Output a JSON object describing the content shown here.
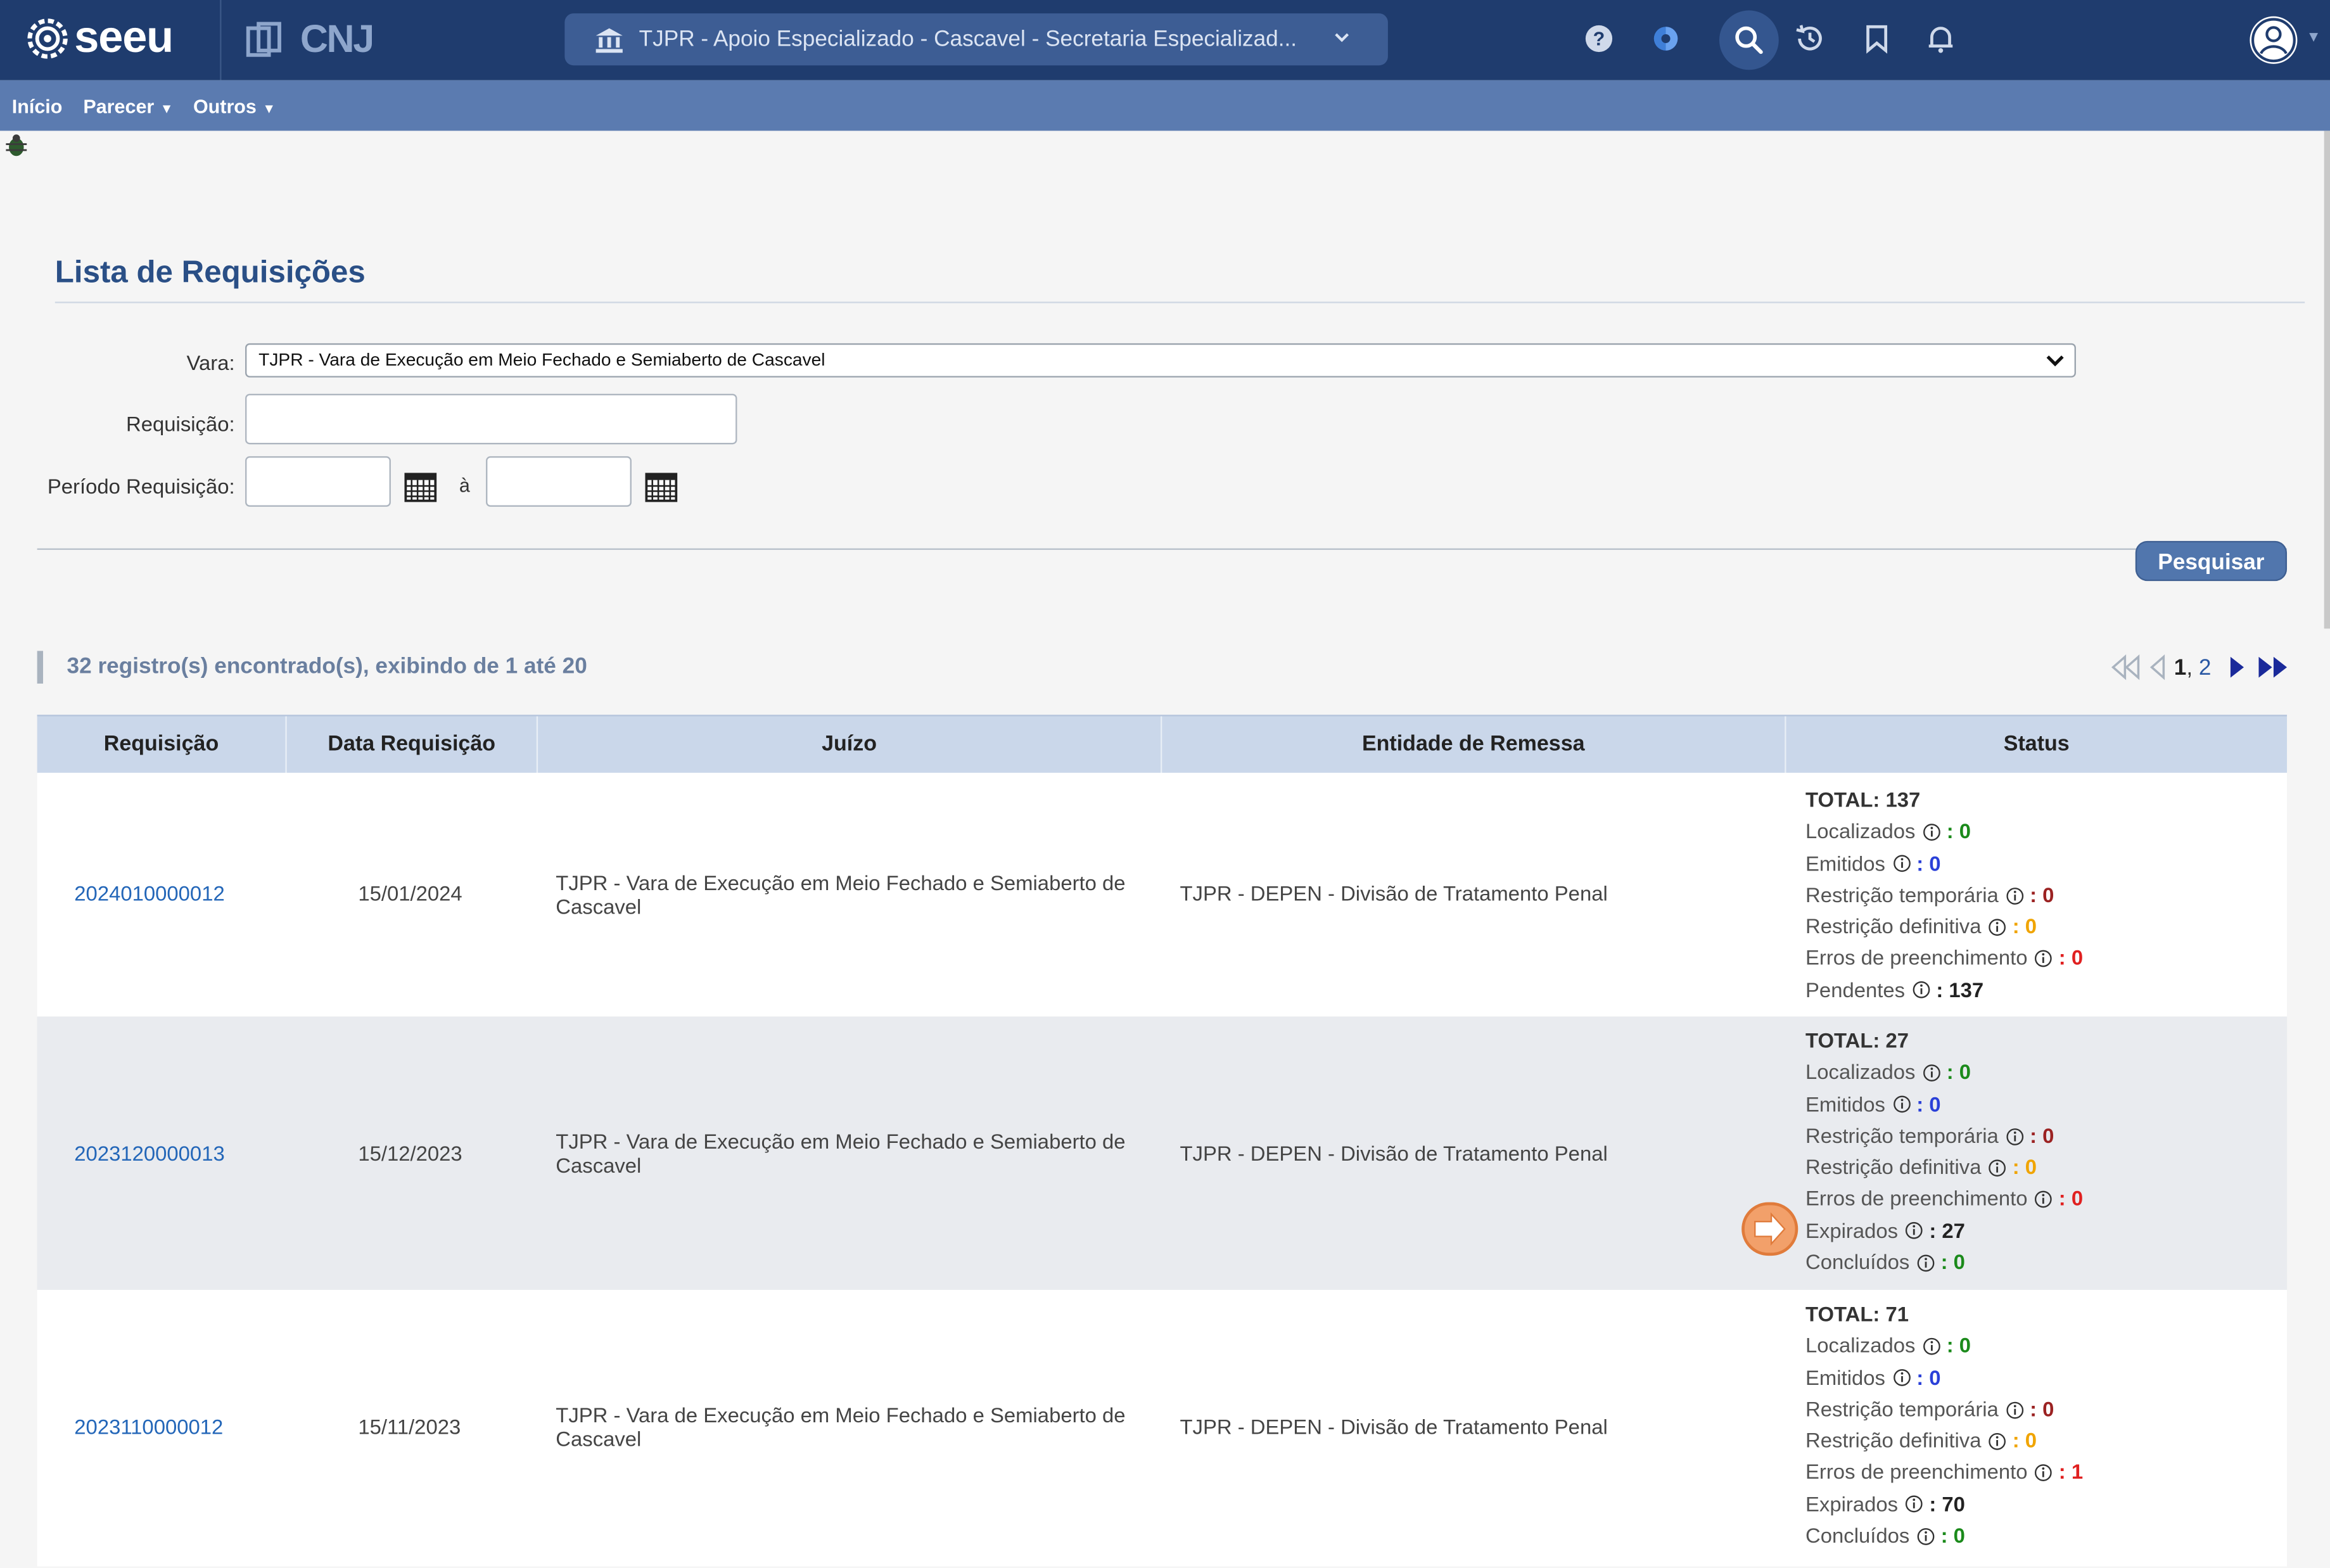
{
  "header": {
    "logo_text": "seeu",
    "cnj_text": "CNJ",
    "location": "TJPR - Apoio Especializado - Cascavel - Secretaria Especializad...",
    "icons": [
      "help-icon",
      "theme-icon",
      "search-icon",
      "history-icon",
      "bookmark-icon",
      "bell-icon",
      "user-icon"
    ],
    "colors": {
      "topbar": "#1f3c6e",
      "menubar": "#5b7bb0"
    }
  },
  "menu": {
    "inicio": "Início",
    "parecer": "Parecer",
    "outros": "Outros"
  },
  "page": {
    "title": "Lista de Requisições"
  },
  "form": {
    "vara_label": "Vara:",
    "vara_value": "TJPR - Vara de Execução em Meio Fechado e Semiaberto de Cascavel",
    "requisicao_label": "Requisição:",
    "requisicao_value": "",
    "periodo_label": "Período Requisição:",
    "periodo_sep": "à",
    "periodo_inicio": "",
    "periodo_fim": "",
    "search_button": "Pesquisar"
  },
  "results": {
    "summary": "32 registro(s) encontrado(s), exibindo de 1 até 20",
    "pager": {
      "current": "1",
      "sep": ",",
      "next_page": "2"
    }
  },
  "table": {
    "headers": [
      "Requisição",
      "Data Requisição",
      "Juízo",
      "Entidade de Remessa",
      "Status"
    ],
    "rows": [
      {
        "requisicao": "2024010000012",
        "data": "15/01/2024",
        "juizo_l1": "TJPR - Vara de Execução em Meio Fechado e Semiaberto de",
        "juizo_l2": "Cascavel",
        "entidade": "TJPR - DEPEN - Divisão de Tratamento Penal",
        "total": "TOTAL: 137",
        "status": [
          {
            "label": "Localizados",
            "value": ": 0",
            "color": "green"
          },
          {
            "label": "Emitidos",
            "value": ": 0",
            "color": "blue"
          },
          {
            "label": "Restrição temporária",
            "value": ": 0",
            "color": "darkred"
          },
          {
            "label": "Restrição definitiva",
            "value": ": 0",
            "color": "orange"
          },
          {
            "label": "Erros de preenchimento",
            "value": ": 0",
            "color": "red"
          },
          {
            "label": "Pendentes",
            "value": ": 137",
            "color": "dark"
          }
        ]
      },
      {
        "requisicao": "2023120000013",
        "data": "15/12/2023",
        "juizo_l1": "TJPR - Vara de Execução em Meio Fechado e Semiaberto de",
        "juizo_l2": "Cascavel",
        "entidade": "TJPR - DEPEN - Divisão de Tratamento Penal",
        "total": "TOTAL: 27",
        "status": [
          {
            "label": "Localizados",
            "value": ": 0",
            "color": "green"
          },
          {
            "label": "Emitidos",
            "value": ": 0",
            "color": "blue"
          },
          {
            "label": "Restrição temporária",
            "value": ": 0",
            "color": "darkred"
          },
          {
            "label": "Restrição definitiva",
            "value": ": 0",
            "color": "orange"
          },
          {
            "label": "Erros de preenchimento",
            "value": ": 0",
            "color": "red"
          },
          {
            "label": "Expirados",
            "value": ": 27",
            "color": "dark"
          },
          {
            "label": "Concluídos",
            "value": ": 0",
            "color": "green"
          }
        ]
      },
      {
        "requisicao": "2023110000012",
        "data": "15/11/2023",
        "juizo_l1": "TJPR - Vara de Execução em Meio Fechado e Semiaberto de",
        "juizo_l2": "Cascavel",
        "entidade": "TJPR - DEPEN - Divisão de Tratamento Penal",
        "total": "TOTAL: 71",
        "status": [
          {
            "label": "Localizados",
            "value": ": 0",
            "color": "green"
          },
          {
            "label": "Emitidos",
            "value": ": 0",
            "color": "blue"
          },
          {
            "label": "Restrição temporária",
            "value": ": 0",
            "color": "darkred"
          },
          {
            "label": "Restrição definitiva",
            "value": ": 0",
            "color": "orange"
          },
          {
            "label": "Erros de preenchimento",
            "value": ": 1",
            "color": "red"
          },
          {
            "label": "Expirados",
            "value": ": 70",
            "color": "dark"
          },
          {
            "label": "Concluídos",
            "value": ": 0",
            "color": "green"
          }
        ]
      }
    ]
  }
}
